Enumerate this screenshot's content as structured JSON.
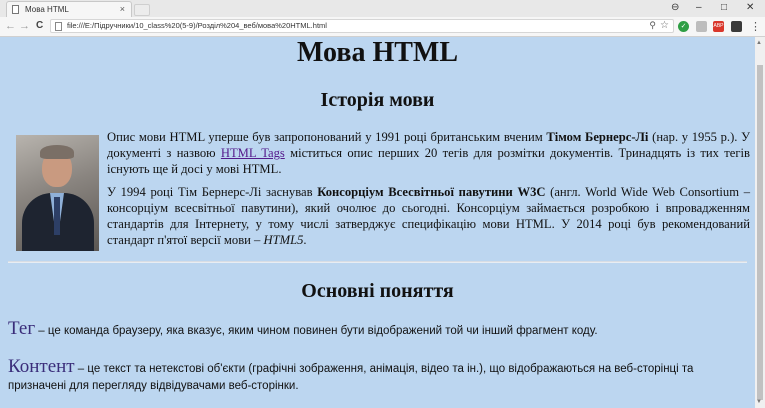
{
  "browser": {
    "tab_title": "Мова HTML",
    "tab_close": "×",
    "url": "file:///E:/Підручники/10_class%20(5-9)/Розділ%204_веб/мова%20HTML.html",
    "window_controls": {
      "user": "⊖",
      "minimize": "–",
      "maximize": "□",
      "close": "✕"
    },
    "nav": {
      "back": "←",
      "forward": "→",
      "reload": "C"
    },
    "omnibox_icons": {
      "zoom": "⚲",
      "bookmark": "☆"
    },
    "extensions": [
      {
        "name": "check-icon",
        "color": "#2e9e44",
        "glyph": "✓"
      },
      {
        "name": "extension-gray-icon",
        "color": "#bdbdbd",
        "glyph": ""
      },
      {
        "name": "abp-icon",
        "color": "#d9372b",
        "glyph": "ABP"
      },
      {
        "name": "shield-icon",
        "color": "#3a3a3a",
        "glyph": ""
      }
    ],
    "menu": "⋮"
  },
  "page": {
    "title": "Мова HTML",
    "history_heading": "Історія мови",
    "p1": {
      "a": "Опис мови HTML уперше був запропонований у 1991 році британським вченим ",
      "name": "Тімом Бернерс-Лі",
      "b": " (нар. у 1955 р.). У документі з назвою ",
      "link": "HTML Tags",
      "c": " міститься опис перших 20 тегів для розмітки документів. Тринадцять із тих тегів існують ще й досі у мові HTML."
    },
    "p2": {
      "a": "У 1994 році Тім Бернерс-Лі заснував ",
      "org": "Консорціум Всесвітньої павутини W3C",
      "b": " (англ. World Wide Web Consortium – консорціум всесвітньої павутини), який очолює до сьогодні. Консорціум займається розробкою і впровадженням стандартів для Інтернету, у тому числі затверджує специфікацію мови HTML. У 2014 році був рекомендований стандарт п'ятої версії мови – ",
      "ver": "HTML5",
      "c": "."
    },
    "concepts_heading": "Основні поняття",
    "terms": [
      {
        "word": "Тег",
        "def": " – це команда браузеру, яка вказує, яким чином повинен бути відображений той чи інший фрагмент коду."
      },
      {
        "word": "Контент",
        "def": " – це текст та нетекстові об'єкти (графічні зображення, анімація, відео та ін.), що відображаються на веб-сторінці та призначені для перегляду відвідувачами веб-сторінки."
      }
    ]
  }
}
